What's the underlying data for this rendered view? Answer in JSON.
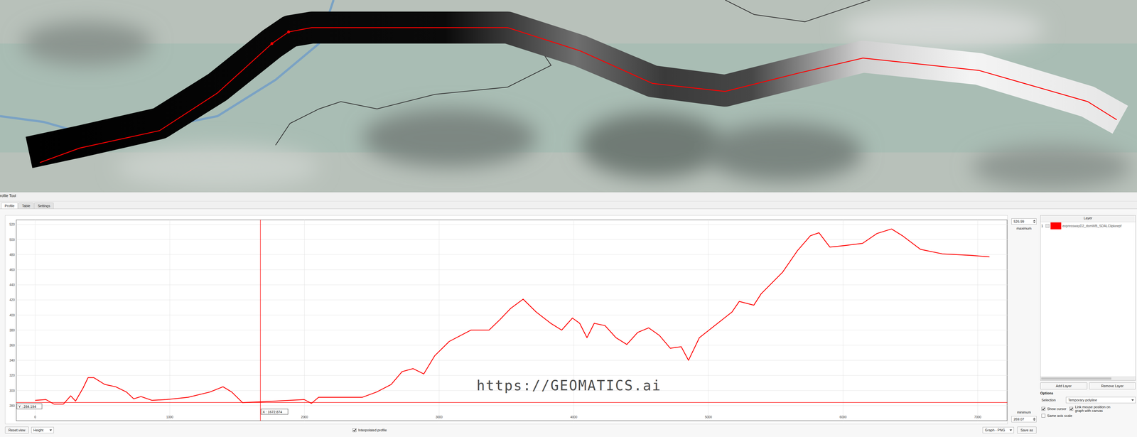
{
  "panel": {
    "title": "rofile Tool"
  },
  "tabs": [
    {
      "label": "Profile",
      "selected": true
    },
    {
      "label": "Table",
      "selected": false
    },
    {
      "label": "Settings",
      "selected": false
    }
  ],
  "chart": {
    "y_ticks": [
      "280",
      "300",
      "320",
      "340",
      "360",
      "380",
      "400",
      "420",
      "440",
      "460",
      "480",
      "500",
      "520"
    ],
    "x_ticks": [
      "0",
      "1000",
      "2000",
      "3000",
      "4000",
      "5000",
      "6000",
      "7000"
    ],
    "series": [
      {
        "name": "expresswayD2_dsmWB_SDALClipkeepf",
        "color": "#ff0000",
        "distances": [
          0,
          80,
          140,
          210,
          264,
          300,
          355,
          393,
          436,
          517,
          598,
          678,
          732,
          786,
          867,
          975,
          1136,
          1298,
          1395,
          1460,
          1540,
          1675,
          1998,
          2052,
          2105,
          2429,
          2536,
          2644,
          2725,
          2806,
          2886,
          2967,
          3075,
          3236,
          3371,
          3452,
          3533,
          3624,
          3721,
          3829,
          3910,
          3990,
          4044,
          4098,
          4152,
          4232,
          4313,
          4394,
          4475,
          4556,
          4636,
          4717,
          4798,
          4852,
          4933,
          5040,
          5175,
          5229,
          5337,
          5391,
          5552,
          5660,
          5757,
          5821,
          5902,
          6010,
          6145,
          6252,
          6360,
          6441,
          6575,
          6737,
          6952,
          7087
        ],
        "values": [
          287,
          288,
          282,
          282,
          293,
          286,
          303,
          317,
          317,
          308,
          305,
          298,
          289,
          292,
          287,
          288,
          291,
          298,
          305,
          298,
          284,
          285,
          288,
          283,
          291,
          291,
          298,
          308,
          325,
          329,
          322,
          346,
          365,
          380,
          380,
          394,
          409,
          421,
          404,
          389,
          380,
          396,
          389,
          370,
          389,
          386,
          370,
          361,
          377,
          383,
          373,
          356,
          358,
          340,
          370,
          385,
          404,
          418,
          413,
          428,
          457,
          485,
          505,
          509,
          490,
          492,
          495,
          508,
          514,
          505,
          487,
          481,
          479,
          477
        ]
      }
    ],
    "cursor": {
      "x": 1672.874,
      "y": 284.194,
      "x_label": "X : 1672.874",
      "y_label": "Y : 284.194"
    },
    "watermark": "https://GEOMATICS.ai"
  },
  "range": {
    "maximum_value": "526.99",
    "maximum_label": "maximum",
    "minimum_label": "minimum",
    "minimum_value": "269.07"
  },
  "layers": {
    "header": "Layer",
    "rows": [
      {
        "index": "1",
        "checked": false,
        "color": "#ff0000",
        "name": "expresswayD2_dsmWB_SDALClipkeepf"
      }
    ],
    "buttons": [
      "Add Layer",
      "Remove Layer"
    ]
  },
  "options": {
    "title": "Options",
    "selection_label": "Selection",
    "selection_value": "Temporary polyline",
    "checkboxes": [
      {
        "label": "Show cursor",
        "checked": true
      },
      {
        "label": "Link mouse position on graph with canvas",
        "checked": true
      },
      {
        "label": "Same axis scale",
        "checked": false
      }
    ]
  },
  "bottom_bar": {
    "reset": "Reset view",
    "mode": "Height",
    "interpolated": {
      "label": "Interpolated profile",
      "checked": true
    },
    "format": "Graph - PNG",
    "save": "Save as"
  }
}
